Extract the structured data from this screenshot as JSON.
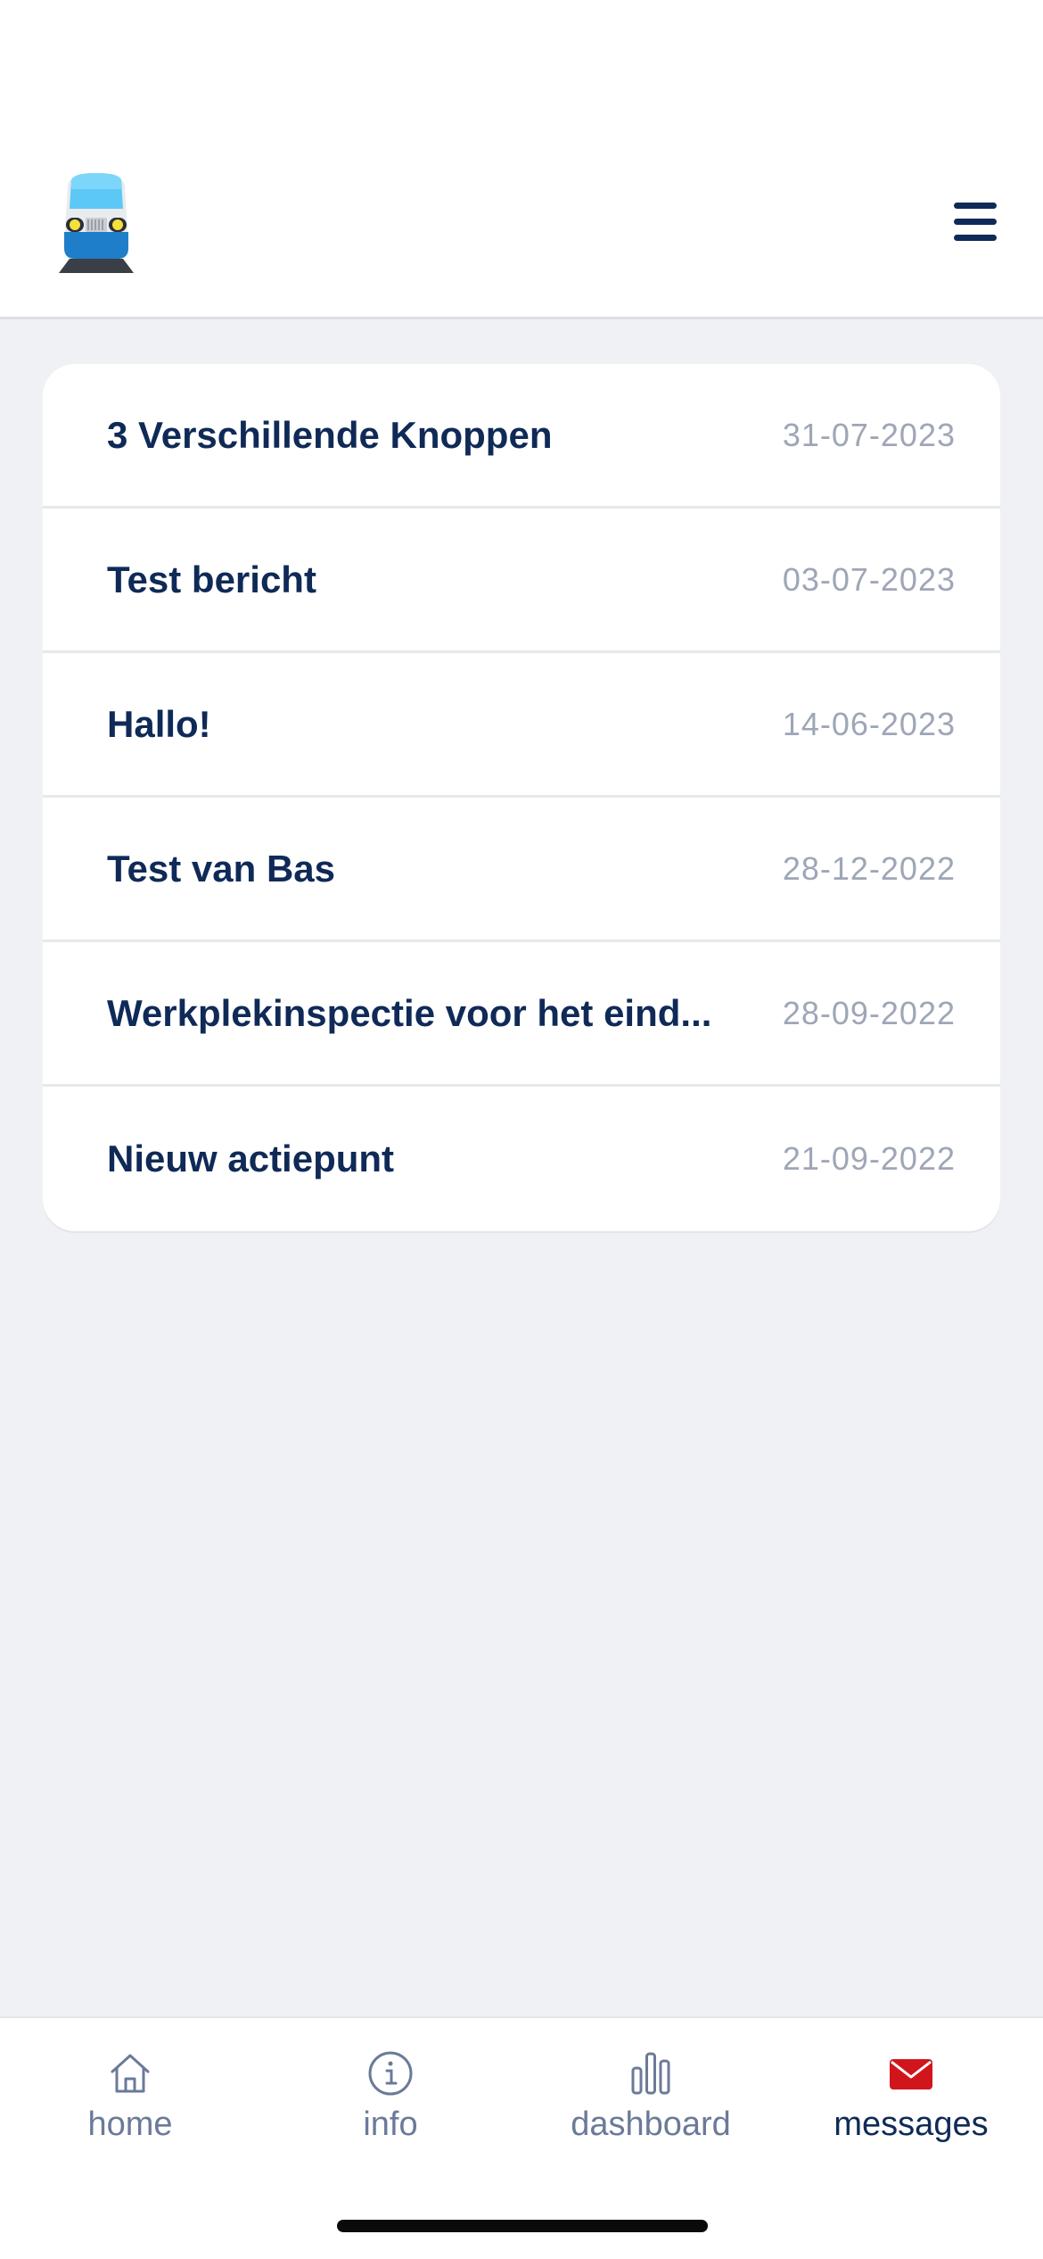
{
  "header": {
    "logo_icon": "train-icon",
    "menu_icon": "hamburger-menu-icon"
  },
  "messages": [
    {
      "title": "3 Verschillende Knoppen",
      "date": "31-07-2023"
    },
    {
      "title": "Test bericht",
      "date": "03-07-2023"
    },
    {
      "title": "Hallo!",
      "date": "14-06-2023"
    },
    {
      "title": "Test van Bas",
      "date": "28-12-2022"
    },
    {
      "title": "Werkplekinspectie voor het eind...",
      "date": "28-09-2022"
    },
    {
      "title": "Nieuw actiepunt",
      "date": "21-09-2022"
    }
  ],
  "tabs": [
    {
      "label": "home",
      "icon": "home-icon"
    },
    {
      "label": "info",
      "icon": "info-icon"
    },
    {
      "label": "dashboard",
      "icon": "bar-chart-icon"
    },
    {
      "label": "messages",
      "icon": "envelope-icon",
      "active": true
    }
  ],
  "colors": {
    "primary": "#0f2a57",
    "date_gray": "#9ea6b7",
    "tab_inactive": "#6b7a99",
    "active_icon": "#d0161c",
    "background": "#f0f1f4"
  }
}
